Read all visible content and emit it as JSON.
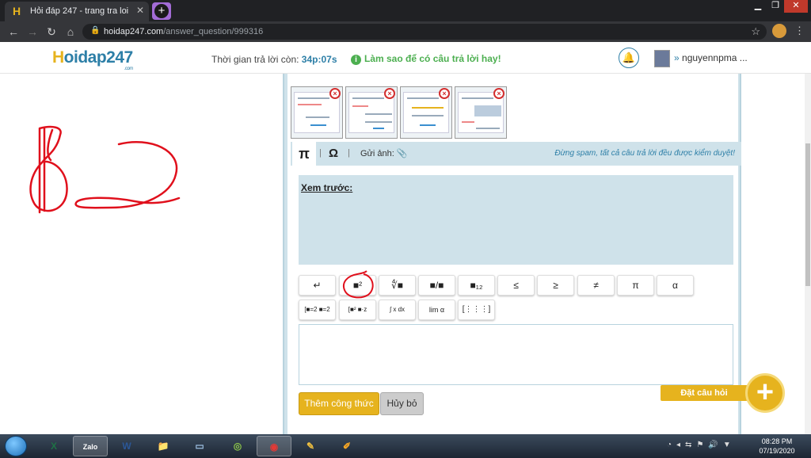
{
  "browser": {
    "tab_title": "Hỏi đáp 247 - trang tra loi",
    "tab_close": "✕",
    "new_tab": "+",
    "url_host": "hoidap247.com",
    "url_path": "/answer_question/999316",
    "window_controls": [
      "▁",
      "❐",
      "✕"
    ]
  },
  "header": {
    "logo_h": "H",
    "logo_rest": "oidap247",
    "logo_sub": ".com",
    "timer_label": "Thời gian trả lời còn: ",
    "timer_value": "34p:07s",
    "howto": "Làm sao để có câu trả lời hay!",
    "username": "nguyennpma ..."
  },
  "answer": {
    "tab_pi": "π",
    "tab_omega": "Ω",
    "send_image": "Gửi ảnh:",
    "warning": "Đừng spam, tất cả câu trả lời đều được kiểm duyệt!",
    "preview_label": "Xem trước:",
    "keyboard_row1": [
      "↵",
      "■²",
      "∜■",
      "■/■",
      "■₁₂",
      "≤",
      "≥",
      "≠",
      "π",
      "α"
    ],
    "keyboard_row2": [
      "[■=2 ■=2",
      "[■² ■·z",
      "∫ x dx",
      "lim α",
      "[⋮⋮⋮]"
    ],
    "add_formula": "Thêm công thức",
    "cancel": "Hủy bỏ"
  },
  "ask_question": "Đặt câu hỏi",
  "ask_plus": "+",
  "taskbar": {
    "apps": [
      "X",
      "Zalo",
      "W",
      "📁",
      "▭",
      "◎",
      "◉",
      "✎",
      "✐"
    ],
    "time": "08:28 PM",
    "date": "07/19/2020"
  },
  "colors": {
    "brand_blue": "#2d7fa7",
    "brand_yellow": "#e6b31e",
    "panel_bg": "#cfe2ea",
    "annotation_red": "#e0101c"
  }
}
